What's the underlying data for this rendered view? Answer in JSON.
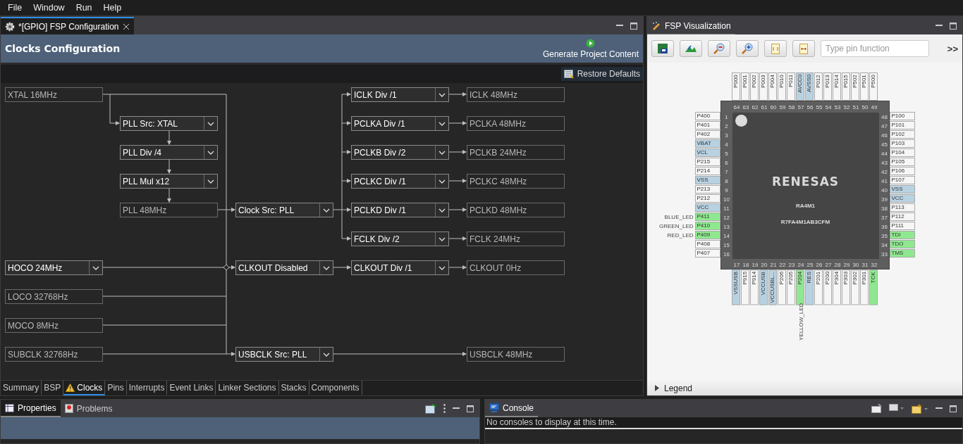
{
  "menu": [
    "File",
    "Window",
    "Run",
    "Help"
  ],
  "editor": {
    "tab": "*[GPIO] FSP Configuration",
    "title": "Clocks Configuration",
    "generate_button": "Generate Project Content",
    "restore_button": "Restore Defaults",
    "clock_nodes": [
      {
        "label": "XTAL 16MHz",
        "kind": "value"
      },
      {
        "label": "HOCO 24MHz",
        "kind": "select"
      },
      {
        "label": "LOCO 32768Hz",
        "kind": "value"
      },
      {
        "label": "MOCO 8MHz",
        "kind": "value"
      },
      {
        "label": "SUBCLK 32768Hz",
        "kind": "value"
      },
      {
        "label": "PLL Src: XTAL",
        "kind": "select"
      },
      {
        "label": "PLL Div /4",
        "kind": "select"
      },
      {
        "label": "PLL Mul x12",
        "kind": "select"
      },
      {
        "label": "PLL 48MHz",
        "kind": "value"
      },
      {
        "label": "Clock Src: PLL",
        "kind": "select"
      },
      {
        "label": "CLKOUT Disabled",
        "kind": "select"
      },
      {
        "label": "USBCLK Src: PLL",
        "kind": "select"
      },
      {
        "label": "ICLK Div /1",
        "kind": "select"
      },
      {
        "label": "PCLKA Div /1",
        "kind": "select"
      },
      {
        "label": "PCLKB Div /2",
        "kind": "select"
      },
      {
        "label": "PCLKC Div /1",
        "kind": "select"
      },
      {
        "label": "PCLKD Div /1",
        "kind": "select"
      },
      {
        "label": "FCLK Div /2",
        "kind": "select"
      },
      {
        "label": "CLKOUT Div /1",
        "kind": "select"
      },
      {
        "label": "ICLK 48MHz",
        "kind": "value"
      },
      {
        "label": "PCLKA 48MHz",
        "kind": "value"
      },
      {
        "label": "PCLKB 24MHz",
        "kind": "value"
      },
      {
        "label": "PCLKC 48MHz",
        "kind": "value"
      },
      {
        "label": "PCLKD 48MHz",
        "kind": "value"
      },
      {
        "label": "FCLK 24MHz",
        "kind": "value"
      },
      {
        "label": "CLKOUT 0Hz",
        "kind": "value"
      },
      {
        "label": "USBCLK 48MHz",
        "kind": "value"
      }
    ],
    "bottom_tabs": [
      {
        "label": "Summary",
        "selected": false,
        "warning": false
      },
      {
        "label": "BSP",
        "selected": false,
        "warning": false
      },
      {
        "label": "Clocks",
        "selected": true,
        "warning": true
      },
      {
        "label": "Pins",
        "selected": false,
        "warning": false
      },
      {
        "label": "Interrupts",
        "selected": false,
        "warning": false
      },
      {
        "label": "Event Links",
        "selected": false,
        "warning": false
      },
      {
        "label": "Linker Sections",
        "selected": false,
        "warning": false
      },
      {
        "label": "Stacks",
        "selected": false,
        "warning": false
      },
      {
        "label": "Components",
        "selected": false,
        "warning": false
      }
    ]
  },
  "visualization": {
    "tab": "FSP Visualization",
    "search_placeholder": "Type pin function",
    "overflow": ">>",
    "chip": {
      "logo": "RENESAS",
      "family": "RA4M1",
      "part": "R7FA4M1AB3CFM",
      "top_pins": [
        {
          "number": "64",
          "name": "P000",
          "kind": "io"
        },
        {
          "number": "63",
          "name": "P001",
          "kind": "io"
        },
        {
          "number": "62",
          "name": "P002",
          "kind": "io"
        },
        {
          "number": "61",
          "name": "P003",
          "kind": "io"
        },
        {
          "number": "60",
          "name": "P004",
          "kind": "io"
        },
        {
          "number": "59",
          "name": "P010",
          "kind": "io"
        },
        {
          "number": "58",
          "name": "P011",
          "kind": "io"
        },
        {
          "number": "57",
          "name": "AVCC0",
          "kind": "power"
        },
        {
          "number": "56",
          "name": "AVSS0",
          "kind": "power"
        },
        {
          "number": "55",
          "name": "P012",
          "kind": "io"
        },
        {
          "number": "54",
          "name": "P013",
          "kind": "io"
        },
        {
          "number": "53",
          "name": "P014",
          "kind": "io"
        },
        {
          "number": "52",
          "name": "P015",
          "kind": "io"
        },
        {
          "number": "51",
          "name": "P502",
          "kind": "io"
        },
        {
          "number": "50",
          "name": "P501",
          "kind": "io"
        },
        {
          "number": "49",
          "name": "P500",
          "kind": "io"
        }
      ],
      "left_pins": [
        {
          "number": "1",
          "name": "P400",
          "kind": "io"
        },
        {
          "number": "2",
          "name": "P401",
          "kind": "io"
        },
        {
          "number": "3",
          "name": "P402",
          "kind": "io"
        },
        {
          "number": "4",
          "name": "VBAT",
          "kind": "power"
        },
        {
          "number": "5",
          "name": "VCL",
          "kind": "power"
        },
        {
          "number": "6",
          "name": "P215",
          "kind": "io"
        },
        {
          "number": "7",
          "name": "P214",
          "kind": "io"
        },
        {
          "number": "8",
          "name": "VSS",
          "kind": "power"
        },
        {
          "number": "9",
          "name": "P213",
          "kind": "io"
        },
        {
          "number": "10",
          "name": "P212",
          "kind": "io"
        },
        {
          "number": "11",
          "name": "VCC",
          "kind": "power"
        },
        {
          "number": "12",
          "name": "P411",
          "kind": "used",
          "signal": "BLUE_LED"
        },
        {
          "number": "13",
          "name": "P410",
          "kind": "used",
          "signal": "GREEN_LED"
        },
        {
          "number": "14",
          "name": "P409",
          "kind": "used",
          "signal": "RED_LED"
        },
        {
          "number": "15",
          "name": "P408",
          "kind": "io"
        },
        {
          "number": "16",
          "name": "P407",
          "kind": "io"
        }
      ],
      "right_pins": [
        {
          "number": "48",
          "name": "P100",
          "kind": "io"
        },
        {
          "number": "47",
          "name": "P101",
          "kind": "io"
        },
        {
          "number": "46",
          "name": "P102",
          "kind": "io"
        },
        {
          "number": "45",
          "name": "P103",
          "kind": "io"
        },
        {
          "number": "44",
          "name": "P104",
          "kind": "io"
        },
        {
          "number": "43",
          "name": "P105",
          "kind": "io"
        },
        {
          "number": "42",
          "name": "P106",
          "kind": "io"
        },
        {
          "number": "41",
          "name": "P107",
          "kind": "io"
        },
        {
          "number": "40",
          "name": "VSS",
          "kind": "power"
        },
        {
          "number": "39",
          "name": "VCC",
          "kind": "power"
        },
        {
          "number": "38",
          "name": "P113",
          "kind": "io"
        },
        {
          "number": "37",
          "name": "P112",
          "kind": "io"
        },
        {
          "number": "36",
          "name": "P111",
          "kind": "io"
        },
        {
          "number": "35",
          "name": "TDI",
          "kind": "used"
        },
        {
          "number": "34",
          "name": "TDO",
          "kind": "used"
        },
        {
          "number": "33",
          "name": "TMS",
          "kind": "used"
        }
      ],
      "bottom_pins": [
        {
          "number": "17",
          "name": "VSSUSB",
          "kind": "power"
        },
        {
          "number": "18",
          "name": "P915",
          "kind": "io"
        },
        {
          "number": "19",
          "name": "P914",
          "kind": "io"
        },
        {
          "number": "20",
          "name": "VCCUSB",
          "kind": "power"
        },
        {
          "number": "21",
          "name": "VCCUSBL...",
          "kind": "power"
        },
        {
          "number": "22",
          "name": "P206",
          "kind": "io"
        },
        {
          "number": "23",
          "name": "P205",
          "kind": "io"
        },
        {
          "number": "24",
          "name": "P204",
          "kind": "used",
          "signal": "YELLOW_LED"
        },
        {
          "number": "25",
          "name": "RES",
          "kind": "power"
        },
        {
          "number": "26",
          "name": "P201",
          "kind": "io"
        },
        {
          "number": "27",
          "name": "P200",
          "kind": "io"
        },
        {
          "number": "28",
          "name": "P304",
          "kind": "io"
        },
        {
          "number": "29",
          "name": "P303",
          "kind": "io"
        },
        {
          "number": "30",
          "name": "P302",
          "kind": "io"
        },
        {
          "number": "31",
          "name": "P301",
          "kind": "io"
        },
        {
          "number": "32",
          "name": "TCK",
          "kind": "used"
        }
      ]
    },
    "legend": {
      "label": "Legend",
      "expanded": false
    }
  },
  "properties_panel": {
    "tabs": [
      {
        "label": "Properties",
        "selected": true
      },
      {
        "label": "Problems",
        "selected": false
      }
    ]
  },
  "console": {
    "tab": "Console",
    "message": "No consoles to display at this time."
  }
}
